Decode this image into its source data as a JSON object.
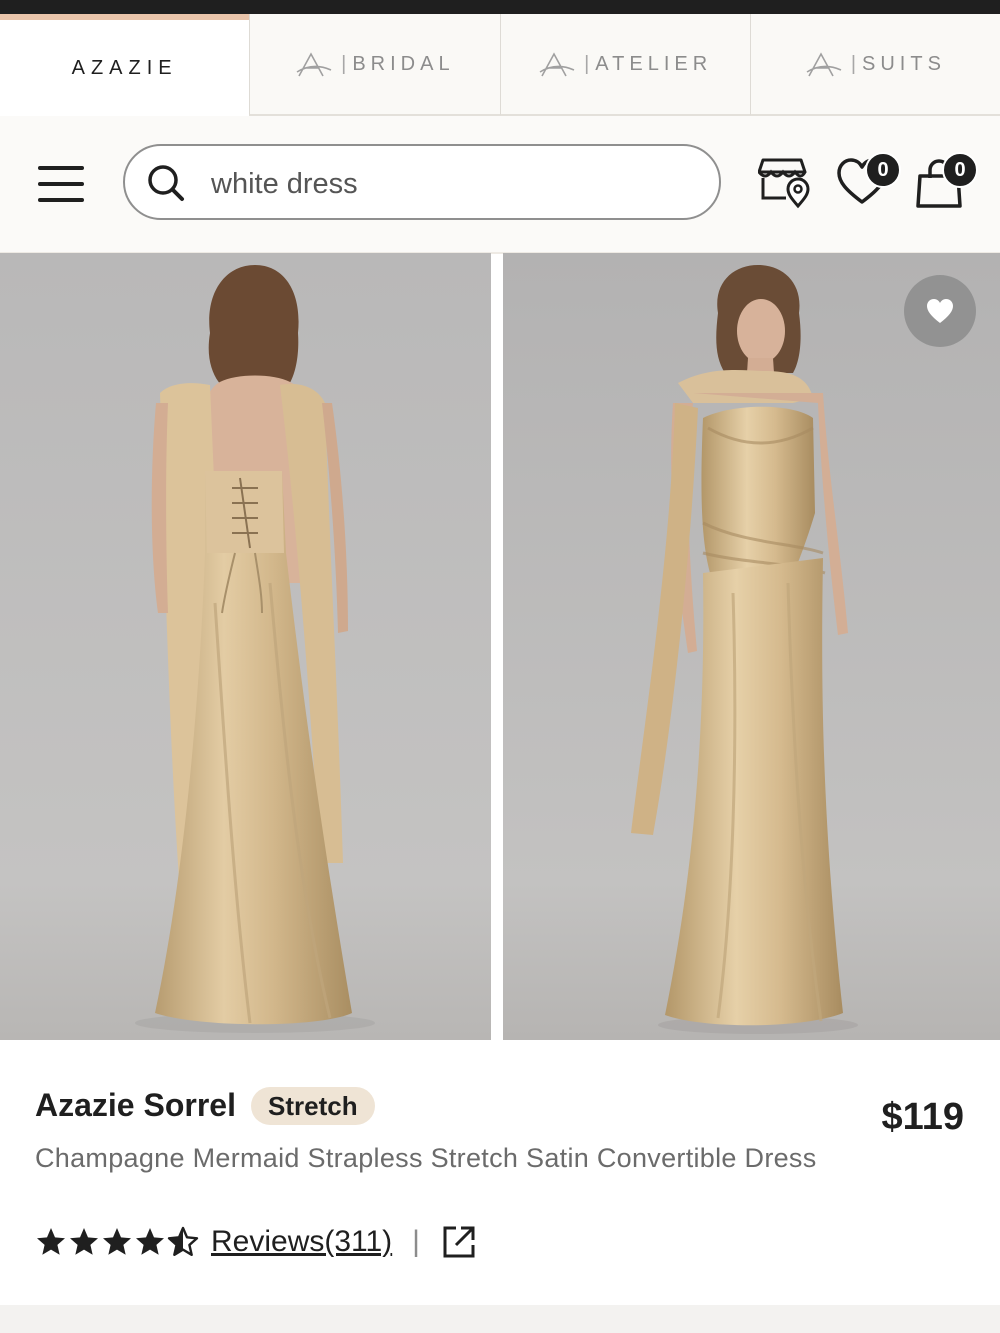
{
  "brands": [
    {
      "label": "AZAZIE",
      "active": true
    },
    {
      "label": "BRIDAL",
      "active": false
    },
    {
      "label": "ATELIER",
      "active": false
    },
    {
      "label": "SUITS",
      "active": false
    }
  ],
  "brand_separator": "|",
  "search": {
    "value": "white dress"
  },
  "header": {
    "wishlist_count": "0",
    "cart_count": "0"
  },
  "icons": {
    "menu": "hamburger-menu-icon",
    "search": "search-icon",
    "store": "store-locator-icon",
    "wishlist": "heart-icon",
    "cart": "shopping-bag-icon",
    "favorite": "heart-icon",
    "external": "external-link-icon"
  },
  "product": {
    "name": "Azazie Sorrel",
    "tag": "Stretch",
    "price": "$119",
    "description": "Champagne Mermaid Strapless Stretch Satin Convertible Dress",
    "rating": 4.5,
    "reviews_label": "Reviews(311)",
    "divider": "|"
  },
  "colors": {
    "dress": "#d6bb8f",
    "backdrop": "#bdbcbb",
    "active_tab_accent": "#e8c4aa",
    "tag_bg": "#efe4d5"
  }
}
